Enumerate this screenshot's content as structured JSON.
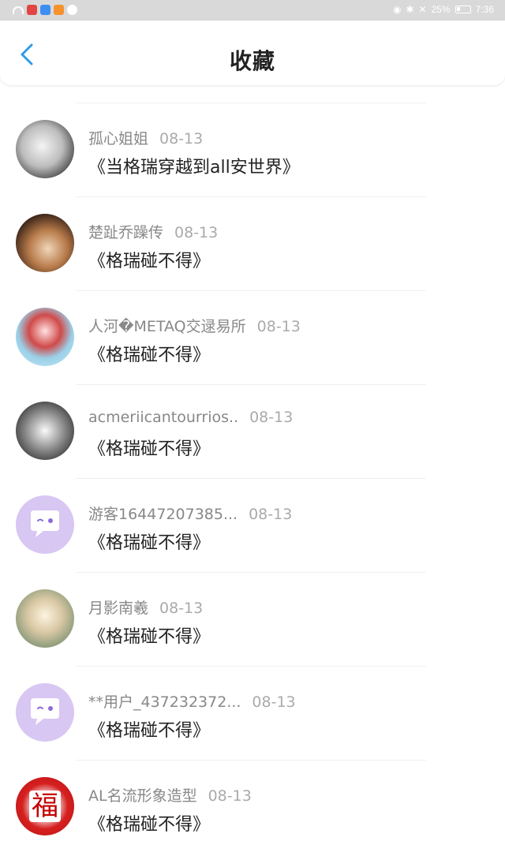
{
  "status_bar": {
    "battery": "25%",
    "time": "7:36",
    "battery_level": 0.25
  },
  "header": {
    "title": "收藏"
  },
  "items": [
    {
      "user": "孤心姐姐",
      "date": "08-13",
      "book": "《当格瑞穿越到all安世界》",
      "avatar": "anime-girl-avatar"
    },
    {
      "user": "楚趾乔躁传",
      "date": "08-13",
      "book": "《格瑞碰不得》",
      "avatar": "woman-portrait-avatar"
    },
    {
      "user": "人河�METAQ交逯易所",
      "date": "08-13",
      "book": "《格瑞碰不得》",
      "avatar": "cartoon-girl-avatar"
    },
    {
      "user": "acmeriicantourrios..",
      "date": "08-13",
      "book": "《格瑞碰不得》",
      "avatar": "bw-portrait-avatar"
    },
    {
      "user": "游客16447207385...",
      "date": "08-13",
      "book": "《格瑞碰不得》",
      "avatar": "default-chat-avatar"
    },
    {
      "user": "月影南羲",
      "date": "08-13",
      "book": "《格瑞碰不得》",
      "avatar": "painted-figure-avatar"
    },
    {
      "user": "**用户_437232372...",
      "date": "08-13",
      "book": "《格瑞碰不得》",
      "avatar": "default-chat-avatar"
    },
    {
      "user": "AL名流形象造型",
      "date": "08-13",
      "book": "《格瑞碰不得》",
      "avatar": "fu-character-avatar",
      "avatar_text": "福"
    }
  ],
  "colors": {
    "accent": "#2f9be8",
    "default_avatar_bg": "#d8c6f3"
  }
}
